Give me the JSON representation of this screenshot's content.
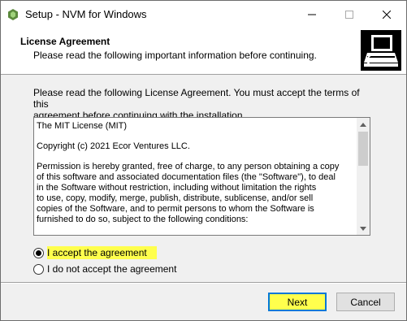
{
  "window": {
    "title": "Setup - NVM for Windows"
  },
  "header": {
    "title": "License Agreement",
    "subtitle": "Please read the following important information before continuing."
  },
  "body": {
    "intro_line1": "Please read the following License Agreement. You must accept the terms of this",
    "intro_line2": "agreement before continuing with the installation.",
    "license": {
      "heading": "The MIT License (MIT)",
      "copyright": "Copyright (c) 2021 Ecor Ventures LLC.",
      "lines": [
        "Permission is hereby granted, free of charge, to any person obtaining a copy",
        "of this software and associated documentation files (the \"Software\"), to deal",
        "in the Software without restriction, including without limitation the rights",
        "to use, copy, modify, merge, publish, distribute, sublicense, and/or sell",
        "copies of the Software, and to permit persons to whom the Software is",
        "furnished to do so, subject to the following conditions:"
      ]
    },
    "options": {
      "accept": "I accept the agreement",
      "decline": "I do not accept the agreement",
      "selected": "accept"
    }
  },
  "footer": {
    "next_label": "Next",
    "cancel_label": "Cancel"
  },
  "colors": {
    "highlight": "#ffff4d",
    "focus_border": "#0078d7",
    "app_icon": "#5b8a3c"
  },
  "icons": {
    "app": "nvm-app-icon",
    "header": "computer-install-icon",
    "minimize": "minimize-icon",
    "maximize": "maximize-icon",
    "close": "close-icon"
  }
}
